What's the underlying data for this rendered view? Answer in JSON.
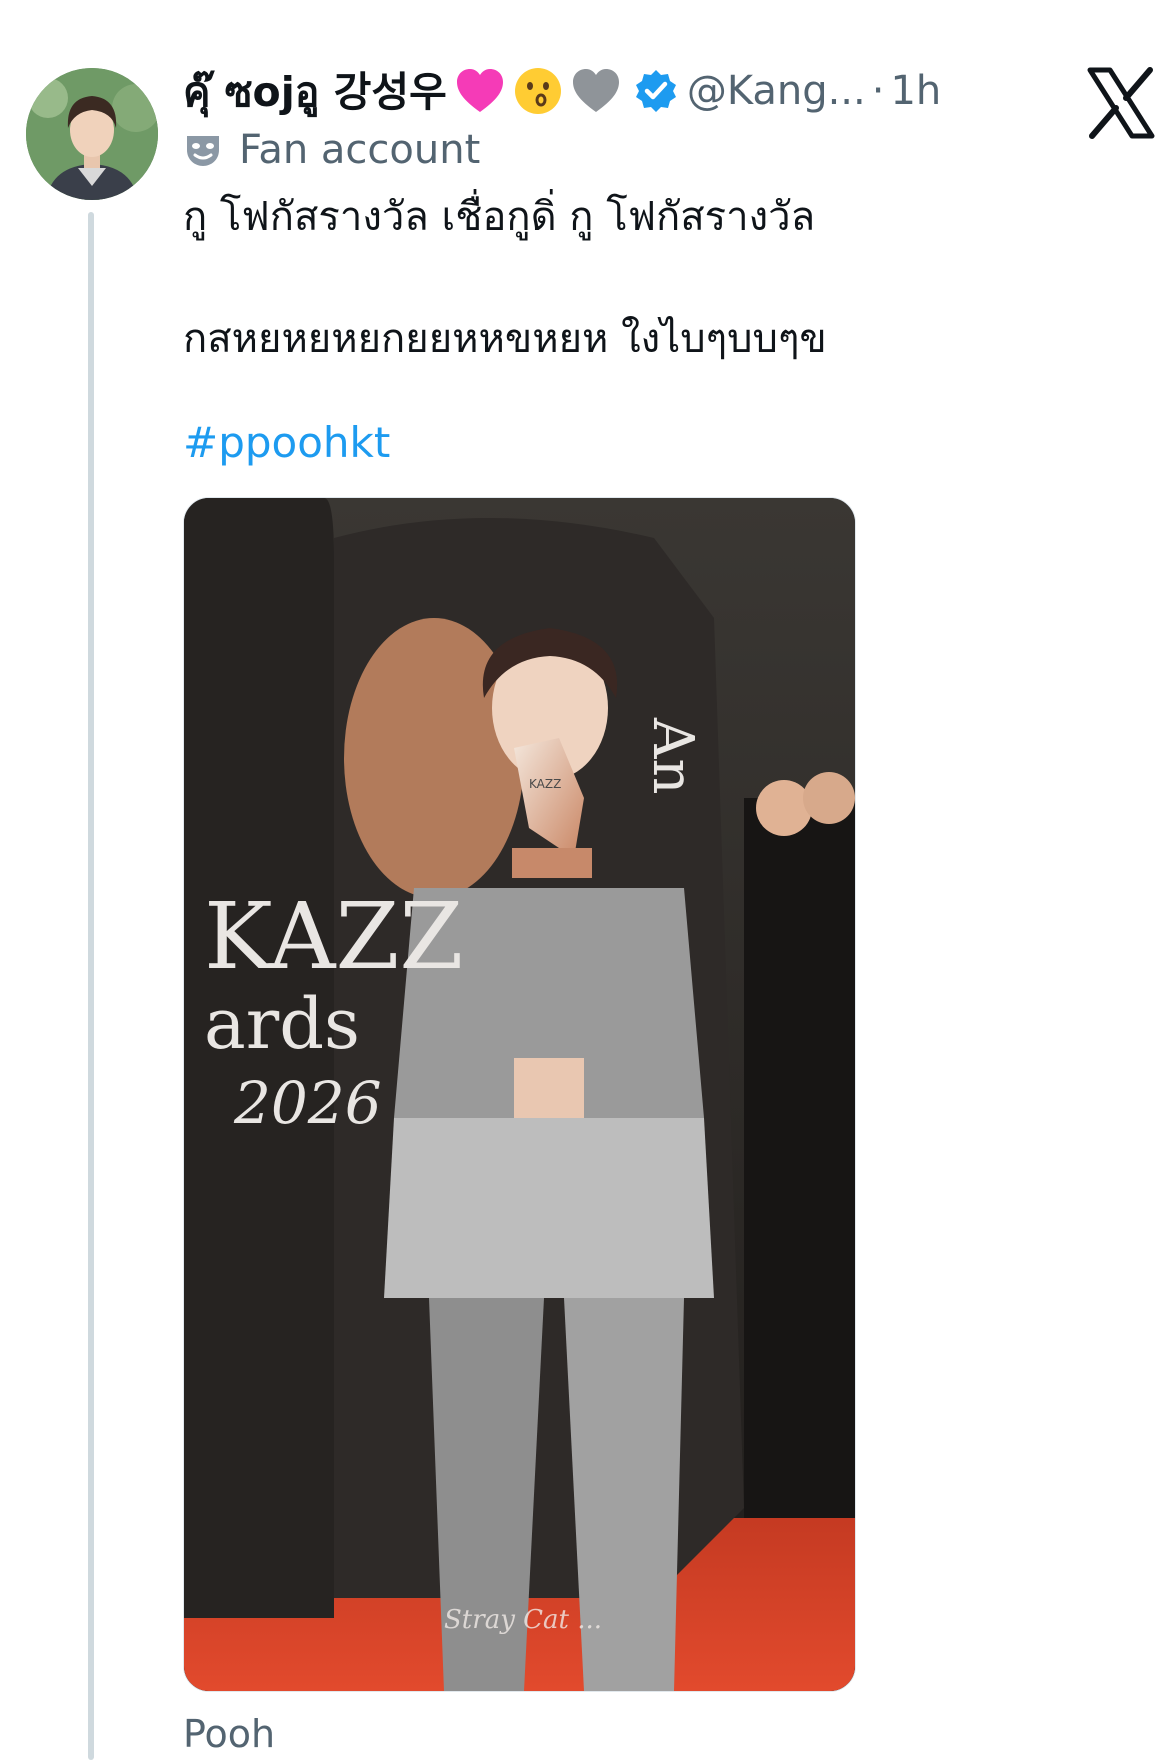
{
  "tweet": {
    "display_name": "คุ๊ ซojอู 강성우",
    "emojis": [
      "pink-heart",
      "kissing-face",
      "grey-heart"
    ],
    "verified": true,
    "handle": "@Kang...",
    "separator": "·",
    "timestamp": "1h",
    "badge_label": "Fan account",
    "text_lines": [
      "กู โฟกัสรางวัล เชื่อกูดิ่ กู โฟกัสรางวัล",
      "กสหยหยหยกยยหหขหยห ใงไบๆบบๆข"
    ],
    "hashtag": "#ppoohkt",
    "media_texts": {
      "brand": "KAZZ",
      "awards": "ards",
      "year": "2026",
      "side_text": "An",
      "trophy_label": "KAZZ",
      "watermark": "Stray Cat ..."
    },
    "below_media_text": "Pooh"
  },
  "colors": {
    "link": "#1d9bf0",
    "secondary_text": "#536471",
    "verified_badge": "#1d9bf0",
    "thread_line": "#cfd9de"
  },
  "icons": {
    "platform": "x-logo-icon",
    "badge": "theater-mask-icon",
    "verified": "verified-badge-icon"
  }
}
